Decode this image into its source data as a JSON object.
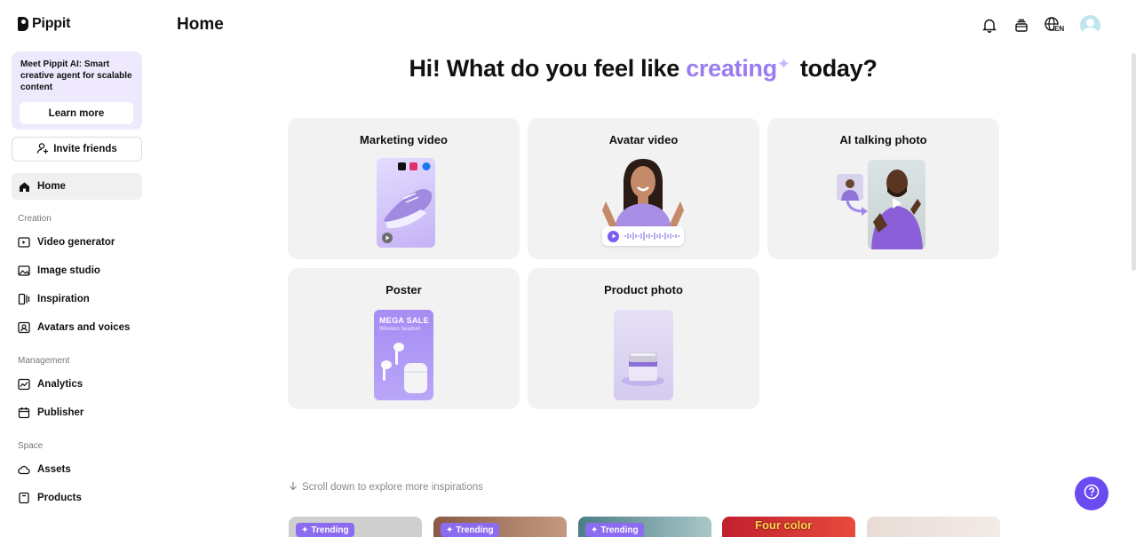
{
  "brand": {
    "name": "Pippit"
  },
  "sidebar": {
    "promo": {
      "text": "Meet Pippit AI: Smart creative agent for scalable content",
      "button": "Learn more"
    },
    "invite": "Invite friends",
    "home": "Home",
    "sections": {
      "creation": "Creation",
      "management": "Management",
      "space": "Space"
    },
    "creation_items": [
      "Video generator",
      "Image studio",
      "Inspiration",
      "Avatars and voices"
    ],
    "management_items": [
      "Analytics",
      "Publisher"
    ],
    "space_items": [
      "Assets",
      "Products"
    ]
  },
  "header": {
    "title": "Home",
    "language": "EN"
  },
  "hero": {
    "prefix": "Hi! What do you feel like",
    "accent": "creating",
    "suffix": "today?"
  },
  "cards": [
    "Marketing video",
    "Avatar video",
    "AI talking photo",
    "Poster",
    "Product photo"
  ],
  "poster": {
    "headline": "MEGA SALE",
    "subline": "Wireless headset"
  },
  "scroll_hint": "Scroll down to explore more inspirations",
  "trending_label": "Trending",
  "thumb_text": "Four color",
  "colors": {
    "accent": "#9a7cf2",
    "help_button": "#6a4bf0",
    "card_bg": "#f2f2f2",
    "promo_bg": "#efe9fd"
  }
}
